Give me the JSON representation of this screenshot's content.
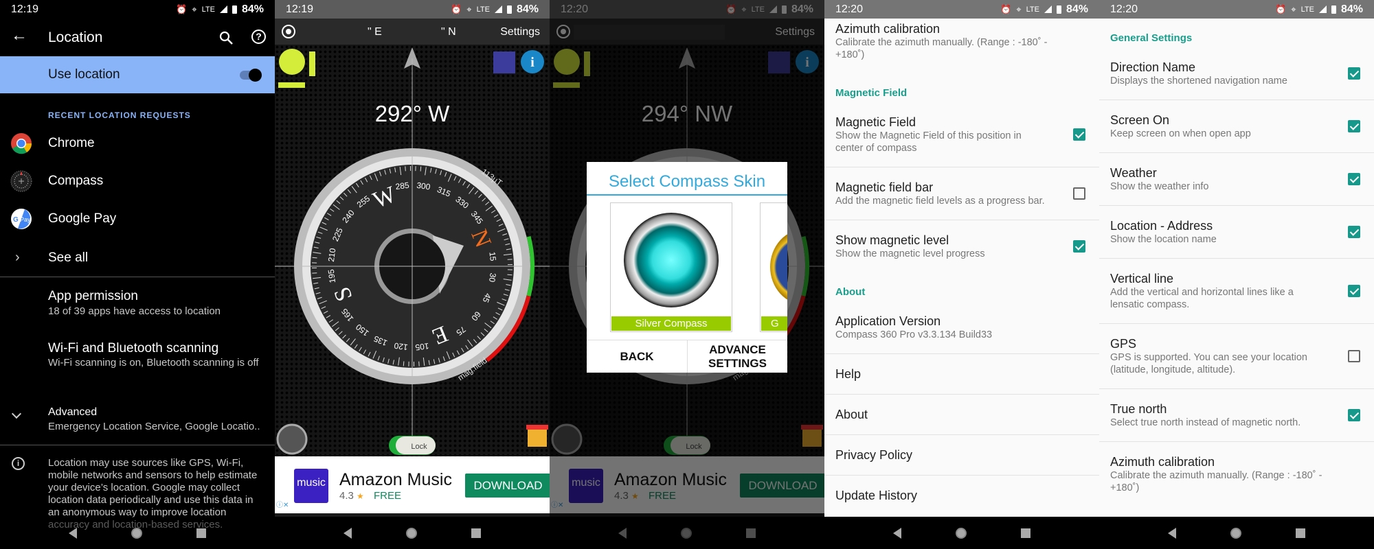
{
  "panel1": {
    "status": {
      "time": "12:19",
      "network": "LTE",
      "battery": "84%"
    },
    "title": "Location",
    "use_location": {
      "label": "Use location",
      "enabled": true
    },
    "recent_header": "RECENT LOCATION REQUESTS",
    "recent_apps": [
      {
        "label": "Chrome",
        "icon": "chrome-icon"
      },
      {
        "label": "Compass",
        "icon": "compass-app-icon"
      },
      {
        "label": "Google Pay",
        "icon": "google-pay-icon"
      }
    ],
    "see_all": "See all",
    "items": [
      {
        "title": "App permission",
        "subtitle": "18 of 39 apps have access to location"
      },
      {
        "title": "Wi-Fi and Bluetooth scanning",
        "subtitle": "Wi-Fi scanning is on, Bluetooth scanning is off"
      },
      {
        "title": "Advanced",
        "subtitle": "Emergency Location Service, Google Locatio.."
      }
    ],
    "info_text": "Location may use sources like GPS, Wi-Fi, mobile networks and sensors to help estimate your device’s location. Google may collect location data periodically and use this data in an anonymous way to improve location accuracy and location-based services.",
    "accent": "#8ab4f8"
  },
  "compass_app": {
    "coords_e": "\" E",
    "coords_n": "\" N",
    "settings_label": "Settings",
    "mag_value": "113µT",
    "mag_label": "mag.field",
    "lock_label": "Lock",
    "dial_labels": [
      "N",
      "15",
      "30",
      "45",
      "60",
      "75",
      "E",
      "105",
      "120",
      "135",
      "150",
      "165",
      "S",
      "195",
      "210",
      "225",
      "240",
      "255",
      "W",
      "285",
      "300",
      "315",
      "330",
      "345"
    ],
    "ad": {
      "name": "Amazon Music",
      "icon_text": "music",
      "rating": "4.3",
      "star": "★",
      "price": "FREE",
      "button": "DOWNLOAD"
    }
  },
  "panel2": {
    "status": {
      "time": "12:19",
      "network": "LTE",
      "battery": "84%"
    },
    "heading": "292° W",
    "heading_deg": 292
  },
  "panel3": {
    "status": {
      "time": "12:20",
      "network": "LTE",
      "battery": "84%"
    },
    "heading": "294° NW",
    "heading_deg": 294,
    "dialog": {
      "title": "Select Compass Skin",
      "skins": [
        "Silver Compass",
        "G"
      ],
      "back": "BACK",
      "advance_line1": "ADVANCE",
      "advance_line2": "SETTINGS"
    }
  },
  "panel4": {
    "status": {
      "time": "12:20",
      "network": "LTE",
      "battery": "84%"
    },
    "list": [
      {
        "type": "item",
        "title": "Azimuth calibration",
        "subtitle": "Calibrate the azimuth manually. (Range : -180˚ - +180˚)",
        "checked": null,
        "nodiv": true
      },
      {
        "type": "header",
        "title": "Magnetic Field"
      },
      {
        "type": "item",
        "title": "Magnetic Field",
        "subtitle": "Show the Magnetic Field of this position in center of compass",
        "checked": true
      },
      {
        "type": "item",
        "title": "Magnetic field bar",
        "subtitle": "Add the magnetic field levels as a progress bar.",
        "checked": false
      },
      {
        "type": "item",
        "title": "Show magnetic level",
        "subtitle": "Show the magnetic level progress",
        "checked": true,
        "nodiv": true
      },
      {
        "type": "header",
        "title": "About"
      },
      {
        "type": "item",
        "title": "Application Version",
        "subtitle": "Compass 360 Pro v3.3.134  Build33",
        "checked": null
      },
      {
        "type": "item",
        "title": "Help",
        "checked": null
      },
      {
        "type": "item",
        "title": "About",
        "checked": null
      },
      {
        "type": "item",
        "title": "Privacy Policy",
        "checked": null
      },
      {
        "type": "item",
        "title": "Update History",
        "checked": null,
        "nodiv": true
      }
    ]
  },
  "panel5": {
    "status": {
      "time": "12:20",
      "network": "LTE",
      "battery": "84%"
    },
    "list": [
      {
        "type": "header",
        "title": "General Settings"
      },
      {
        "type": "item",
        "title": "Direction Name",
        "subtitle": "Displays the shortened navigation name",
        "checked": true
      },
      {
        "type": "item",
        "title": "Screen On",
        "subtitle": "Keep screen on when open app",
        "checked": true
      },
      {
        "type": "item",
        "title": "Weather",
        "subtitle": "Show the weather info",
        "checked": true
      },
      {
        "type": "item",
        "title": "Location - Address",
        "subtitle": "Show the location name",
        "checked": true
      },
      {
        "type": "item",
        "title": "Vertical line",
        "subtitle": "Add the vertical and horizontal lines like a lensatic compass.",
        "checked": true
      },
      {
        "type": "item",
        "title": "GPS",
        "subtitle": "GPS is supported. You can see your location (latitude, longitude, altitude).",
        "checked": false
      },
      {
        "type": "item",
        "title": "True north",
        "subtitle": "Select true north instead of magnetic north.",
        "checked": true
      },
      {
        "type": "item",
        "title": "Azimuth calibration",
        "subtitle": "Calibrate the azimuth manually. (Range : -180˚ - +180˚)",
        "checked": null,
        "nodiv": true
      }
    ],
    "accent": "#16998a"
  }
}
